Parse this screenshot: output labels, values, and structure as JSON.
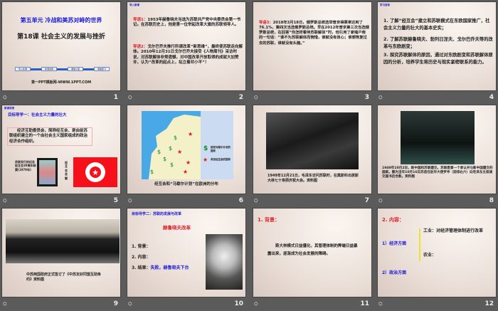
{
  "slides": [
    {
      "number": "1",
      "unit_title": "第五单元 冷战和美苏对峙的世界",
      "lesson_title": "第18课  社会主义的发展与挫折",
      "nav_buttons": [
        "导入新课",
        "新课讲授",
        "课堂小结",
        "课堂练习"
      ],
      "footer": "第一PPT模板网-WWW.1PPT.COM"
    },
    {
      "number": "2",
      "tag": "导入新课",
      "lead1_label": "导语1：",
      "lead1": "1953年赫鲁晓夫当选为苏联共产党中央委员会第一书记。在苏联历史上，他是第一位举起改革大旗的苏联领导人。",
      "lead2_label": "导语2：",
      "lead2": "戈尔巴乔夫推行所谓改革“新思维”，最终使苏联走向解体。2010年12月31日戈尔巴乔夫接受《人物周刊》采访时说，对苏联解体非常遗憾，对中国改革开放取得的成就大加赞许，认为“改革的起点上，站立着邓小平”！"
    },
    {
      "number": "3",
      "lead3_label": "导语3：",
      "lead3": "2018年3月18日，俄罗斯总统选举普京得票率达到了76.1%，第四次当选俄罗斯总统。早在2012年普京第三次当选俄罗斯总统，在回答“你怎样看待苏联解体”时，他引用了家喻户晓的一句话：“谁不为苏联解体而惋惜，谁就没有良心；谁想恢复过去的苏联，谁就没有头脑。”"
    },
    {
      "number": "4",
      "tag": "学习目标",
      "goals": [
        "1. 了解“经互会”建立和苏联模式在东欧国家推广，社会主义力量的壮大的基本史实；",
        "2. 了解苏联赫鲁晓夫、勃列日涅夫、戈尔巴乔夫等的改革与东欧剧变；",
        "3. 探究苏联解体的原因，通过对东欧剧变和苏联解体原因的分析，培养学生将历史与现实紧密联系的能力。"
      ]
    },
    {
      "number": "5",
      "tag": "新课讲授",
      "heading": "目标导学一：社会主义力量的壮大",
      "text": "经济互助委员会，简称经互会，是由前苏联组织建立的一个由社会主义国家组成的政治经济合作组织。",
      "stamp_caption": "苏联发行的纪念经互会30周年邮票(1979年)",
      "emblem_caption": "经互会会徽"
    },
    {
      "number": "6",
      "legend": [
        "接受马歇尔计划的国家",
        "参加经互会的国家"
      ],
      "caption": "经互会和“马歇尔计划”在欧洲的分布"
    },
    {
      "number": "7",
      "caption": "1949年12月21日，毛泽东访问苏联时，在莫斯科出席斯大林七十寿辰庆祝大会。资料图"
    },
    {
      "number": "8",
      "caption": "1949年10月2日，新中国和苏联建交。苏联是第一个承认并与新中国建交的国家。图为当年10月16日苏首任驻华大使罗申（前排右六）向毛泽东主席递交国书后合影。资料图"
    },
    {
      "number": "9",
      "caption": "中苏两国政府正式签订了《中苏友好同盟互助条约》资料图"
    },
    {
      "number": "10",
      "heading": "目标导学二：苏联的发展与改革",
      "subheading": "赫鲁晓夫改革",
      "items": [
        "1. 背景：",
        "2. 内容：",
        "3. 结果："
      ],
      "result": "失败，赫鲁晓夫下台"
    },
    {
      "number": "11",
      "heading": "1. 背景：",
      "text": "斯大林模式日益僵化，其管理体制的弊端日益暴露出来，逐渐成为社会发展的障碍。"
    },
    {
      "number": "12",
      "heading": "2. 内容：",
      "econ": "1）经济方面",
      "industry": "工业：对经济管理体制进行改革",
      "agriculture": "农业：",
      "politics": "2）政治方面"
    }
  ],
  "colors": {
    "red": "#e0202a",
    "blue": "#1a1ad8",
    "background": "#5b5b5b"
  }
}
